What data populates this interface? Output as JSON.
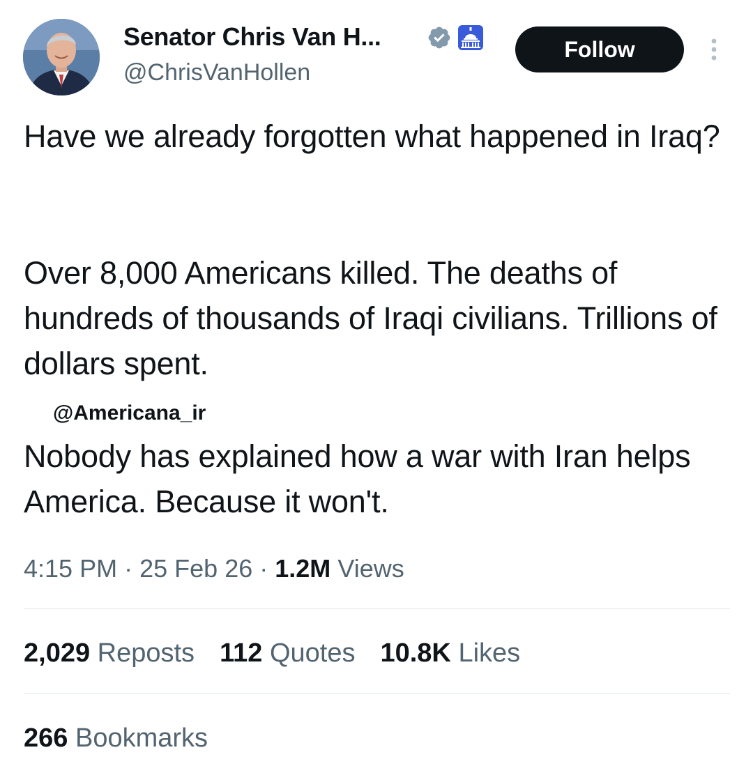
{
  "author": {
    "display_name": "Senator Chris Van H...",
    "handle": "@ChrisVanHollen",
    "verified_badge": "verified-badge-icon",
    "affiliation_badge": "us-capitol-icon"
  },
  "header": {
    "follow_label": "Follow",
    "more_icon": "more-vertical-icon"
  },
  "tweet": {
    "paragraph_1": "Have we already forgotten what happened in Iraq?",
    "paragraph_2": "Over 8,000 Americans killed. The deaths of hundreds of thousands of Iraqi civilians. Trillions of dollars spent.",
    "paragraph_3": "Nobody has explained how a war with Iran helps America. Because it won't."
  },
  "watermark": "@Americana_ir",
  "meta": {
    "time": "4:15 PM",
    "date": "25 Feb 26",
    "separator": "·",
    "views_count": "1.2M",
    "views_label": "Views"
  },
  "stats": {
    "reposts_count": "2,029",
    "reposts_label": "Reposts",
    "quotes_count": "112",
    "quotes_label": "Quotes",
    "likes_count": "10.8K",
    "likes_label": "Likes",
    "bookmarks_count": "266",
    "bookmarks_label": "Bookmarks"
  },
  "colors": {
    "text_primary": "#0f1419",
    "text_secondary": "#536471",
    "verified_gray": "#829aab",
    "gov_blue": "#3a5bd9",
    "divider": "#eff3f4"
  }
}
